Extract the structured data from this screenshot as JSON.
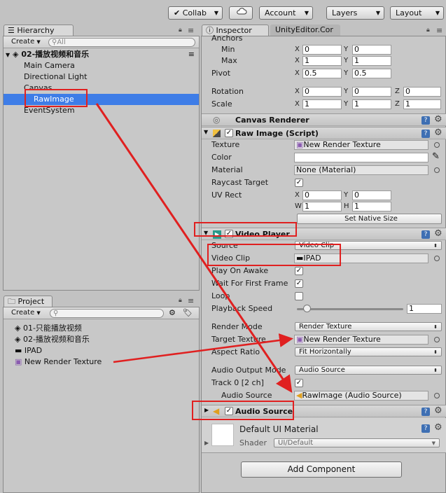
{
  "toolbar": {
    "collab": "Collab",
    "account": "Account",
    "layers": "Layers",
    "layout": "Layout"
  },
  "hierarchy": {
    "tab": "Hierarchy",
    "create": "Create",
    "search_placeholder": "All",
    "scene": "02-播放视频和音乐",
    "items": [
      "Main Camera",
      "Directional Light",
      "Canvas",
      "RawImage",
      "EventSystem"
    ]
  },
  "project": {
    "tab": "Project",
    "create": "Create",
    "items": [
      "01-只能播放视频",
      "02-播放视频和音乐",
      "IPAD",
      "New Render Texture"
    ]
  },
  "inspector": {
    "tabs": [
      "Inspector",
      "UnityEditor.Cor"
    ],
    "rect": {
      "anchors": "Anchors",
      "min": "Min",
      "max": "Max",
      "min_x": "0",
      "min_y": "0",
      "max_x": "1",
      "max_y": "1",
      "pivot": "Pivot",
      "pivot_x": "0.5",
      "pivot_y": "0.5",
      "rotation": "Rotation",
      "rot_x": "0",
      "rot_y": "0",
      "rot_z": "0",
      "scale": "Scale",
      "scale_x": "1",
      "scale_y": "1",
      "scale_z": "1"
    },
    "axis": {
      "x": "X",
      "y": "Y",
      "z": "Z",
      "w": "W",
      "h": "H"
    },
    "canvas_renderer": "Canvas Renderer",
    "raw_image": {
      "title": "Raw Image (Script)",
      "texture": "Texture",
      "texture_val": "New Render Texture",
      "color": "Color",
      "material": "Material",
      "material_val": "None (Material)",
      "raycast": "Raycast Target",
      "uvrect": "UV Rect",
      "uv_x": "0",
      "uv_y": "0",
      "uv_w": "1",
      "uv_h": "1",
      "native": "Set Native Size"
    },
    "video_player": {
      "title": "Video Player",
      "source": "Source",
      "source_val": "Video Clip",
      "clip": "Video Clip",
      "clip_val": "IPAD",
      "awake": "Play On Awake",
      "wait": "Wait For First Frame",
      "loop": "Loop",
      "speed": "Playback Speed",
      "speed_val": "1",
      "render_mode": "Render Mode",
      "render_mode_val": "Render Texture",
      "target": "Target Texture",
      "target_val": "New Render Texture",
      "aspect": "Aspect Ratio",
      "aspect_val": "Fit Horizontally",
      "audio_mode": "Audio Output Mode",
      "audio_mode_val": "Audio Source",
      "track": "Track 0 [2 ch]",
      "audio_src": "Audio Source",
      "audio_src_val": "RawImage (Audio Source)"
    },
    "audio_source": {
      "title": "Audio Source"
    },
    "material": {
      "name": "Default UI Material",
      "shader": "Shader",
      "shader_val": "UI/Default"
    },
    "add_component": "Add Component"
  },
  "colors": {
    "selection": "#3e7de7",
    "annotation": "#e02020"
  }
}
